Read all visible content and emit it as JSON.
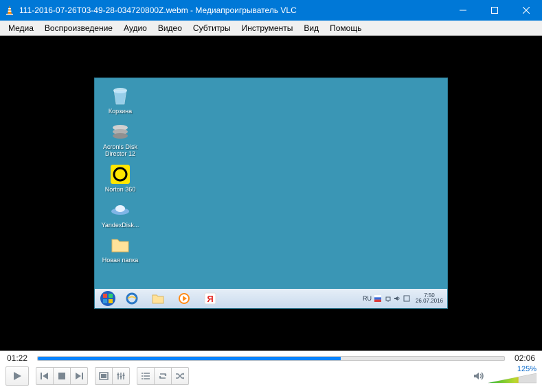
{
  "window": {
    "title": "111-2016-07-26T03-49-28-034720800Z.webm - Медиапроигрыватель VLC"
  },
  "menu": {
    "media": "Медиа",
    "playback": "Воспроизведение",
    "audio": "Аудио",
    "video": "Видео",
    "subtitle": "Субтитры",
    "tools": "Инструменты",
    "view": "Вид",
    "help": "Помощь"
  },
  "video": {
    "desktop_icons": [
      {
        "label": "Корзина"
      },
      {
        "label": "Acronis Disk Director 12"
      },
      {
        "label": "Norton 360"
      },
      {
        "label": "YandexDisk..."
      },
      {
        "label": "Новая папка"
      }
    ],
    "taskbar": {
      "lang": "RU",
      "time": "7:50",
      "date": "26.07.2016"
    }
  },
  "playback": {
    "elapsed": "01:22",
    "total": "02:06",
    "progress_ratio": 0.65
  },
  "volume": {
    "percent_label": "125%",
    "percent": 125
  }
}
